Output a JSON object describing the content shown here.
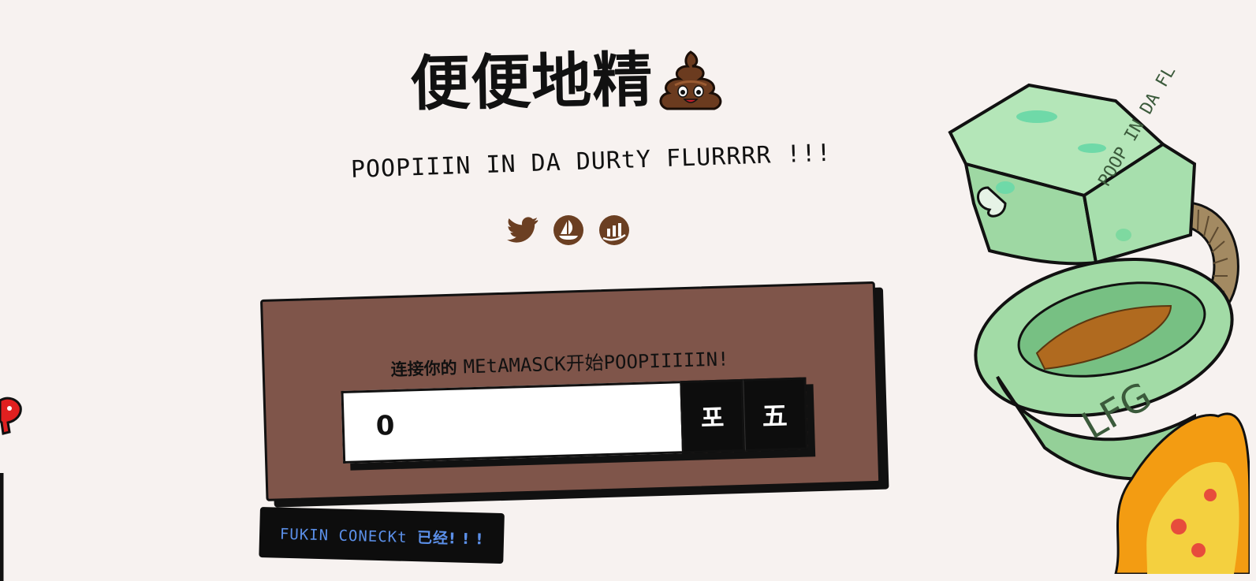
{
  "header": {
    "title": "便便地精",
    "title_emoji_icon": "poop-emoji-icon",
    "subtitle": "POOPIIIN IN DA DURtY FLURRRR !!!"
  },
  "socials": [
    {
      "name": "twitter",
      "icon": "twitter-icon"
    },
    {
      "name": "opensea",
      "icon": "opensea-icon"
    },
    {
      "name": "looksrare",
      "icon": "chart-icon"
    }
  ],
  "mint": {
    "prompt_zh": "连接你的",
    "prompt_en": "MEtAMASCK开始POOPIIIIIN!",
    "quantity_value": "0",
    "button_1": "포",
    "button_2": "五"
  },
  "status": {
    "text_en": "FUKIN CONECKt",
    "text_zh": "已经! ! !"
  },
  "decor": {
    "toilet_lid_text": "POOP IN DA FLUUR",
    "toilet_bowl_text": "LFG"
  },
  "colors": {
    "background": "#f7f2f0",
    "card": "#7f554a",
    "status_text": "#5b8fe8",
    "social_brown": "#6b3f22"
  }
}
